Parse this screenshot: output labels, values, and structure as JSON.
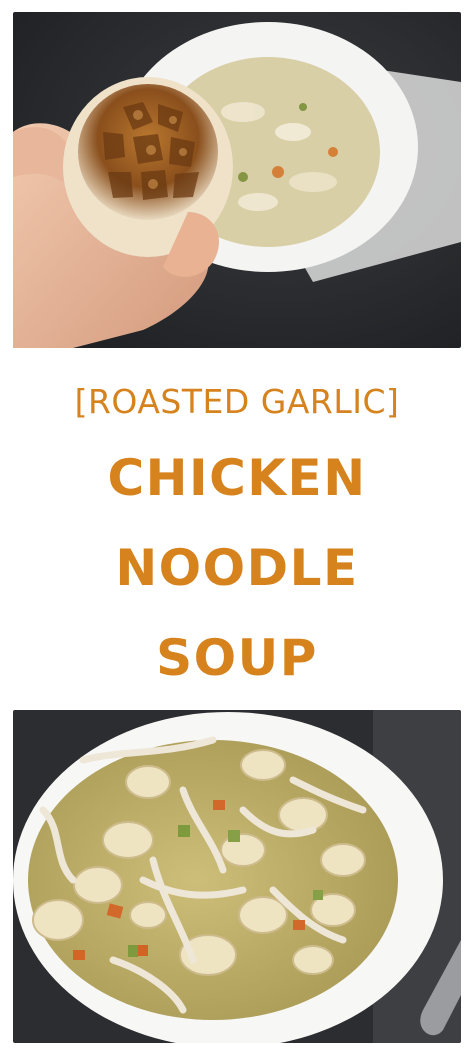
{
  "pin": {
    "subtitle": "[ROASTED GARLIC]",
    "title_lines": [
      "CHICKEN",
      "NOODLE",
      "SOUP"
    ]
  },
  "colors": {
    "title_orange": "#d6831e",
    "background": "#ffffff"
  },
  "images": {
    "top": "hand-holding-roasted-garlic-photo",
    "bottom": "chicken-noodle-soup-bowl-photo"
  }
}
